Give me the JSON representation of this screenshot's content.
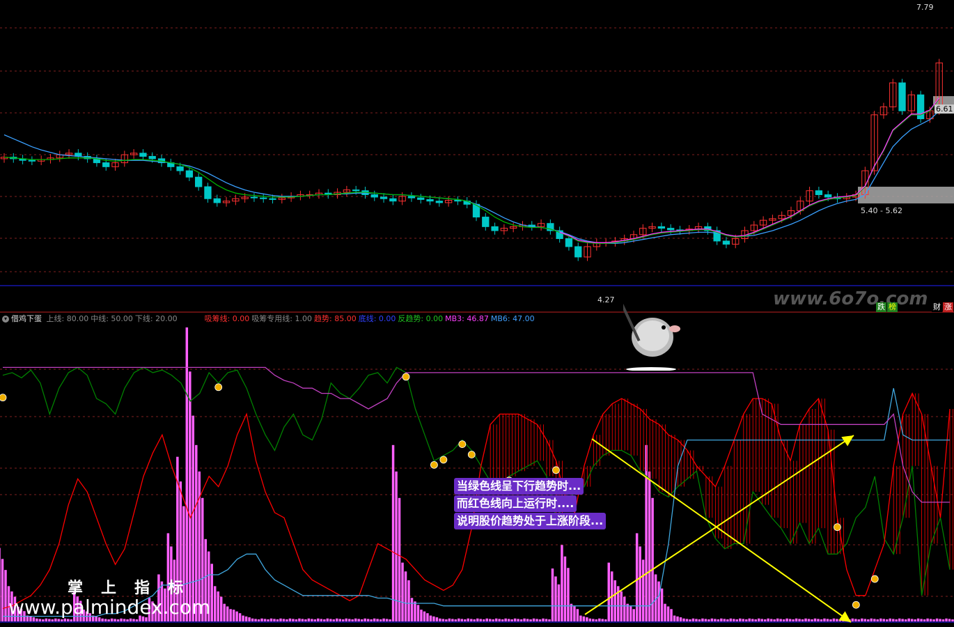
{
  "colors": {
    "background": "#000000",
    "up": "#ff3232",
    "down": "#00c8c8",
    "ma_green": "#00b000",
    "ma_blue": "#3aa0ff",
    "ma_magenta": "#ff30ff",
    "line_green": "#008000",
    "line_red": "#ff0000",
    "line_cyan": "#40a8e0",
    "line_purple": "#c040c0",
    "bars_pink": "#ff60ff",
    "arrow_yellow": "#ffff00"
  },
  "price_panel": {
    "high_label": "7.79",
    "low_label": "4.27",
    "current_label": "6.61",
    "range_label": "5.40 - 5.62",
    "watermark": "www.6o7o.com",
    "tags": {
      "left": "跌",
      "left2": "榜",
      "right": "财",
      "right2": "涨"
    }
  },
  "indicator_panel": {
    "name": "借鸡下蛋",
    "items": [
      {
        "label": "上线:",
        "value": "80.00",
        "color": "#888888"
      },
      {
        "label": "中线:",
        "value": "50.00",
        "color": "#888888"
      },
      {
        "label": "下线:",
        "value": "20.00",
        "color": "#888888"
      },
      {
        "label": "吸筹线:",
        "value": "0.00",
        "color": "#ff3030"
      },
      {
        "label": "吸筹专用线:",
        "value": "1.00",
        "color": "#888888"
      },
      {
        "label": "趋势:",
        "value": "85.00",
        "color": "#ff3030"
      },
      {
        "label": "底线:",
        "value": "0.00",
        "color": "#3040ff"
      },
      {
        "label": "反趋势:",
        "value": "0.00",
        "color": "#20c020"
      },
      {
        "label": "MB3:",
        "value": "46.87",
        "color": "#ff40ff"
      },
      {
        "label": "MB6:",
        "value": "47.00",
        "color": "#40a0ff"
      }
    ],
    "callout_lines": [
      "当绿色线呈下行趋势时...",
      "而红色线向上运行时....",
      "说明股价趋势处于上涨阶段..."
    ],
    "site_cn": "掌上指标",
    "site_url": "www.palmindex.com"
  },
  "chart_data": [
    {
      "type": "candlestick",
      "title": "",
      "ylim": [
        4.1,
        7.85
      ],
      "y_labels": [
        "7.79",
        "6.61",
        "5.40 - 5.62",
        "4.27"
      ],
      "closes": [
        5.97,
        5.95,
        5.93,
        5.92,
        5.94,
        5.96,
        6.0,
        6.02,
        5.98,
        5.95,
        5.9,
        5.85,
        5.9,
        6.0,
        6.02,
        5.98,
        5.95,
        5.9,
        5.85,
        5.8,
        5.72,
        5.6,
        5.45,
        5.4,
        5.42,
        5.45,
        5.47,
        5.46,
        5.45,
        5.44,
        5.46,
        5.48,
        5.5,
        5.5,
        5.52,
        5.5,
        5.53,
        5.56,
        5.55,
        5.5,
        5.47,
        5.45,
        5.42,
        5.48,
        5.46,
        5.44,
        5.42,
        5.4,
        5.43,
        5.42,
        5.38,
        5.22,
        5.1,
        5.05,
        5.08,
        5.1,
        5.12,
        5.1,
        5.14,
        5.05,
        4.95,
        4.85,
        4.72,
        4.85,
        4.9,
        4.9,
        4.92,
        4.95,
        5.0,
        5.08,
        5.1,
        5.08,
        5.06,
        5.05,
        5.07,
        5.1,
        5.05,
        4.92,
        4.88,
        4.95,
        5.05,
        5.12,
        5.18,
        5.2,
        5.24,
        5.3,
        5.42,
        5.55,
        5.5,
        5.47,
        5.45,
        5.47,
        5.5,
        5.8,
        6.5,
        6.6,
        6.9,
        6.55,
        6.75,
        6.45,
        6.55,
        7.15
      ],
      "ma_green": [
        5.97,
        5.96,
        5.95,
        5.94,
        5.94,
        5.94,
        5.95,
        5.96,
        5.96,
        5.96,
        5.95,
        5.93,
        5.92,
        5.93,
        5.94,
        5.94,
        5.93,
        5.92,
        5.9,
        5.88,
        5.84,
        5.78,
        5.7,
        5.62,
        5.56,
        5.52,
        5.5,
        5.49,
        5.48,
        5.47,
        5.47,
        5.47,
        5.48,
        5.49,
        5.5,
        5.5,
        5.51,
        5.52,
        5.53,
        5.53,
        5.52,
        5.51,
        5.5,
        5.5,
        5.49,
        5.48,
        5.47,
        5.46,
        5.45,
        5.44,
        5.42,
        5.37,
        5.3,
        5.22,
        5.16,
        5.12,
        5.1,
        5.09,
        5.09,
        5.07,
        5.03,
        4.98,
        4.92,
        4.9,
        4.89,
        4.89,
        4.9,
        4.92,
        4.94,
        4.97,
        5.0,
        5.02,
        5.03,
        5.04,
        5.05,
        5.06,
        5.06,
        5.03,
        4.99,
        4.97,
        4.98,
        5.02,
        5.07,
        5.12,
        5.17,
        5.22,
        5.29,
        5.36,
        5.41,
        5.44,
        5.46,
        5.47,
        5.49,
        5.6,
        5.85,
        6.05,
        6.3,
        6.4,
        6.5,
        6.5,
        6.55,
        6.7
      ],
      "ma_blue": [
        6.25,
        6.2,
        6.15,
        6.1,
        6.06,
        6.03,
        6.0,
        5.99,
        5.98,
        5.97,
        5.96,
        5.95,
        5.94,
        5.93,
        5.93,
        5.93,
        5.92,
        5.91,
        5.9,
        5.88,
        5.86,
        5.82,
        5.77,
        5.71,
        5.65,
        5.6,
        5.56,
        5.53,
        5.51,
        5.49,
        5.48,
        5.48,
        5.48,
        5.49,
        5.5,
        5.5,
        5.51,
        5.51,
        5.52,
        5.52,
        5.52,
        5.51,
        5.5,
        5.5,
        5.49,
        5.48,
        5.47,
        5.46,
        5.45,
        5.44,
        5.42,
        5.38,
        5.33,
        5.27,
        5.21,
        5.16,
        5.12,
        5.1,
        5.09,
        5.07,
        5.04,
        5.0,
        4.95,
        4.92,
        4.9,
        4.89,
        4.89,
        4.9,
        4.92,
        4.94,
        4.96,
        4.98,
        5.0,
        5.01,
        5.02,
        5.03,
        5.03,
        5.02,
        5.0,
        4.98,
        4.98,
        4.99,
        5.02,
        5.05,
        5.09,
        5.13,
        5.18,
        5.24,
        5.3,
        5.35,
        5.39,
        5.42,
        5.44,
        5.5,
        5.7,
        5.9,
        6.1,
        6.22,
        6.32,
        6.38,
        6.44,
        6.55
      ]
    },
    {
      "type": "line",
      "title": "",
      "ylim": [
        0,
        100
      ],
      "levels": [
        80,
        50,
        20
      ],
      "series": [
        {
          "name": "",
          "color": "#008000",
          "values": [
            95,
            96,
            94,
            97,
            92,
            80,
            90,
            96,
            98,
            95,
            86,
            84,
            80,
            90,
            96,
            98,
            96,
            97,
            95,
            92,
            85,
            88,
            96,
            92,
            96,
            97,
            90,
            80,
            72,
            66,
            75,
            80,
            72,
            70,
            78,
            92,
            88,
            86,
            90,
            95,
            96,
            92,
            98,
            96,
            82,
            72,
            62,
            64,
            66,
            70,
            66,
            60,
            54,
            52,
            56,
            58,
            60,
            62,
            56,
            40,
            45,
            50,
            52,
            60,
            64,
            66,
            66,
            64,
            58,
            55,
            50,
            48,
            52,
            55,
            58,
            40,
            32,
            28,
            30,
            30,
            50,
            45,
            40,
            36,
            30,
            38,
            30,
            36,
            26,
            26,
            30,
            40,
            44,
            56,
            32,
            26,
            40,
            60,
            10,
            30,
            40,
            20
          ]
        },
        {
          "name": "",
          "color": "#ff0000",
          "values": [
            5,
            6,
            8,
            10,
            14,
            20,
            30,
            45,
            55,
            50,
            40,
            30,
            22,
            28,
            42,
            56,
            65,
            72,
            60,
            50,
            40,
            48,
            56,
            52,
            60,
            72,
            80,
            62,
            50,
            42,
            40,
            30,
            20,
            16,
            14,
            12,
            10,
            8,
            10,
            20,
            30,
            28,
            26,
            24,
            20,
            16,
            14,
            12,
            14,
            20,
            36,
            60,
            76,
            80,
            80,
            80,
            78,
            76,
            70,
            62,
            48,
            42,
            60,
            72,
            80,
            84,
            86,
            84,
            82,
            78,
            76,
            72,
            70,
            66,
            60,
            56,
            52,
            60,
            70,
            80,
            86,
            86,
            84,
            70,
            62,
            76,
            82,
            86,
            74,
            40,
            20,
            10,
            10,
            20,
            30,
            60,
            80,
            88,
            80,
            60,
            40,
            82
          ]
        },
        {
          "name": "",
          "color": "#40a8e0",
          "values": [
            2,
            2,
            2,
            2,
            2,
            2,
            2,
            2,
            2,
            2,
            2,
            3,
            3,
            4,
            6,
            8,
            10,
            14,
            14,
            14,
            15,
            16,
            18,
            18,
            20,
            24,
            26,
            26,
            20,
            16,
            14,
            12,
            10,
            10,
            10,
            10,
            10,
            10,
            10,
            10,
            9,
            9,
            8,
            7,
            7,
            7,
            7,
            6,
            6,
            6,
            6,
            6,
            6,
            6,
            6,
            6,
            6,
            6,
            6,
            6,
            6,
            6,
            6,
            6,
            6,
            6,
            6,
            6,
            6,
            6,
            10,
            30,
            60,
            70,
            70,
            70,
            70,
            70,
            70,
            70,
            70,
            70,
            70,
            70,
            70,
            70,
            70,
            70,
            70,
            70,
            70,
            70,
            70,
            70,
            70,
            90,
            72,
            70,
            70,
            70,
            70,
            70
          ]
        },
        {
          "name": "",
          "color": "#c040c0",
          "values": [
            98,
            98,
            98,
            98,
            98,
            98,
            98,
            98,
            98,
            98,
            98,
            98,
            98,
            98,
            98,
            98,
            98,
            98,
            98,
            98,
            98,
            98,
            98,
            98,
            98,
            98,
            98,
            98,
            98,
            95,
            93,
            92,
            90,
            90,
            88,
            88,
            86,
            86,
            84,
            82,
            84,
            86,
            92,
            96,
            96,
            96,
            96,
            96,
            96,
            96,
            96,
            96,
            96,
            96,
            96,
            96,
            96,
            96,
            96,
            96,
            96,
            96,
            96,
            96,
            96,
            96,
            96,
            96,
            96,
            96,
            96,
            96,
            96,
            96,
            96,
            96,
            96,
            96,
            96,
            96,
            96,
            80,
            78,
            76,
            76,
            76,
            76,
            76,
            76,
            76,
            76,
            76,
            76,
            76,
            76,
            80,
            60,
            50,
            46,
            46,
            46,
            46
          ]
        }
      ],
      "bars": [
        25,
        12,
        5,
        2,
        1,
        1,
        1,
        1,
        10,
        4,
        2,
        1,
        1,
        1,
        1,
        2,
        8,
        16,
        30,
        56,
        100,
        60,
        28,
        12,
        6,
        4,
        2,
        1,
        1,
        1,
        1,
        1,
        1,
        1,
        1,
        1,
        1,
        1,
        1,
        1,
        1,
        1,
        60,
        20,
        8,
        4,
        2,
        1,
        1,
        1,
        1,
        1,
        1,
        1,
        1,
        1,
        1,
        1,
        1,
        18,
        26,
        6,
        2,
        1,
        1,
        20,
        12,
        6,
        30,
        60,
        16,
        6,
        2,
        1,
        1,
        1,
        1,
        1,
        1,
        1,
        1,
        1,
        1,
        1,
        1,
        1,
        1,
        1,
        1,
        1,
        1,
        1,
        1,
        1,
        1,
        1,
        1,
        1,
        1,
        1,
        1,
        1
      ]
    }
  ]
}
